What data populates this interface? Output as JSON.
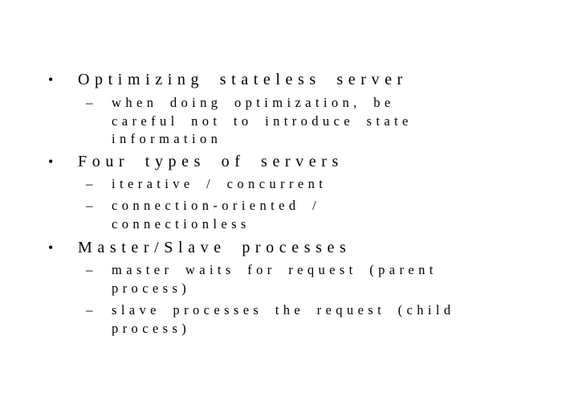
{
  "slide": {
    "bullet_glyph": "•",
    "dash_glyph": "–",
    "items": [
      {
        "text": "Optimizing stateless server",
        "subitems": [
          {
            "lines": [
              "when doing optimization, be",
              "careful not to introduce state",
              "information"
            ]
          }
        ]
      },
      {
        "text": "Four types of servers",
        "subitems": [
          {
            "lines": [
              "iterative / concurrent"
            ]
          },
          {
            "lines": [
              "connection-oriented /",
              "connectionless"
            ]
          }
        ]
      },
      {
        "text": "Master/Slave processes",
        "subitems": [
          {
            "lines": [
              "master waits for request (parent",
              "process)"
            ]
          },
          {
            "lines": [
              "slave processes the request (child",
              "process)"
            ]
          }
        ]
      }
    ]
  }
}
